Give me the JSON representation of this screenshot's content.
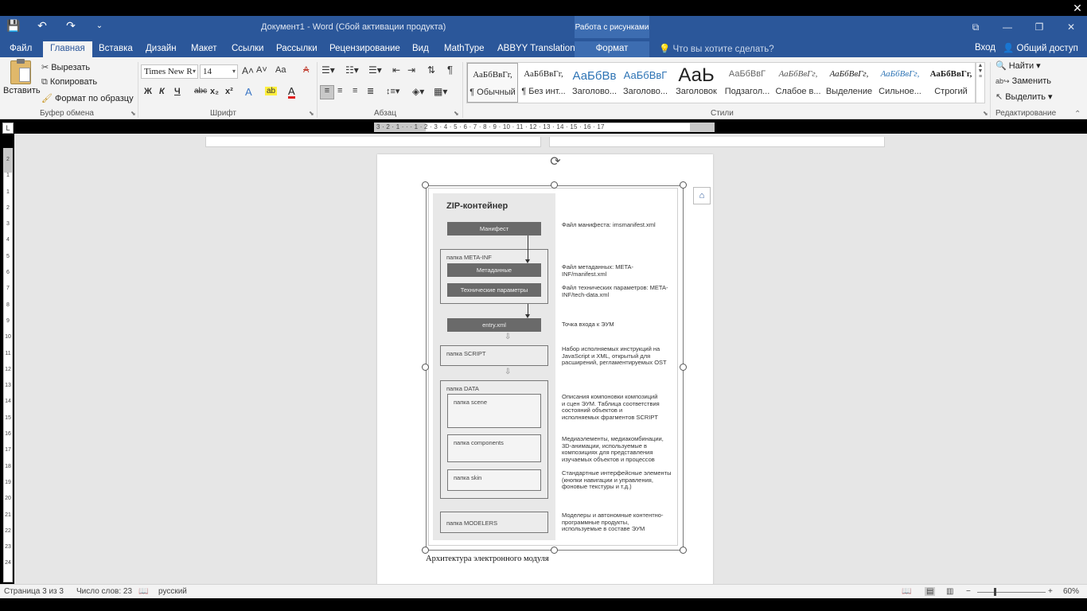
{
  "window": {
    "doc_title": "Документ1 - Word (Сбой активации продукта)",
    "context_tab_group": "Работа с рисунками",
    "controls": [
      "⧉",
      "—",
      "❐",
      "✕"
    ],
    "exit_fullscreen_icon": "✕"
  },
  "qat": {
    "save_icon": "💾",
    "undo_icon": "↶",
    "redo_icon": "↷",
    "customize_icon": "⌄"
  },
  "tabs": [
    "Файл",
    "Главная",
    "Вставка",
    "Дизайн",
    "Макет",
    "Ссылки",
    "Рассылки",
    "Рецензирование",
    "Вид",
    "MathType",
    "ABBYY Translation",
    "Формат"
  ],
  "active_tab": "Главная",
  "tell_me": "Что вы хотите сделать?",
  "login": "Вход",
  "share": "Общий доступ",
  "clipboard": {
    "paste": "Вставить",
    "cut": "Вырезать",
    "copy": "Копировать",
    "format_painter": "Формат по образцу",
    "label": "Буфер обмена"
  },
  "font": {
    "name": "Times New R",
    "size": "14",
    "grow": "A˄",
    "shrink": "A˅",
    "case": "Aa",
    "clear": "A",
    "bold": "Ж",
    "italic": "К",
    "underline": "Ч",
    "strike": "abc",
    "sub": "x₂",
    "sup": "x²",
    "effects": "A",
    "highlight": "ab",
    "color": "A",
    "label": "Шрифт"
  },
  "paragraph": {
    "label": "Абзац",
    "pilcrow": "¶"
  },
  "styles": {
    "label": "Стили",
    "items": [
      {
        "preview": "АаБбВвГг,",
        "name": "¶ Обычный"
      },
      {
        "preview": "АаБбВвГг,",
        "name": "¶ Без инт..."
      },
      {
        "preview": "АаБбВв",
        "name": "Заголово..."
      },
      {
        "preview": "АаБбВвГ",
        "name": "Заголово..."
      },
      {
        "preview": "АаЬ",
        "name": "Заголовок"
      },
      {
        "preview": "АаБбВвГ",
        "name": "Подзагол..."
      },
      {
        "preview": "АаБбВвГг,",
        "name": "Слабое в..."
      },
      {
        "preview": "АаБбВвГг,",
        "name": "Выделение"
      },
      {
        "preview": "АаБбВвГг,",
        "name": "Сильное..."
      },
      {
        "preview": "АаБбВвГг,",
        "name": "Строгий"
      }
    ]
  },
  "editing": {
    "find": "Найти",
    "replace": "Заменить",
    "select": "Выделить",
    "label": "Редактирование"
  },
  "ruler": {
    "corner": "L",
    "h_numbers": "3 · 2 · 1 · · · 1 · 2 · 3 · 4 · 5 · 6 · 7 · 8 · 9 · 10 · 11 · 12 · 13 · 14 · 15 · 16 · 17",
    "v_numbers": [
      "2",
      "1",
      "1",
      "2",
      "3",
      "4",
      "5",
      "6",
      "7",
      "8",
      "9",
      "10",
      "11",
      "12",
      "13",
      "14",
      "15",
      "16",
      "17",
      "18",
      "19",
      "20",
      "21",
      "22",
      "23",
      "24"
    ]
  },
  "diagram": {
    "title": "ZIP-контейнер",
    "manifest": "Манифест",
    "meta_folder": "папка META-INF",
    "metadata": "Метаданные",
    "tech_params": "Технические параметры",
    "entry": "entry.xml",
    "script_folder": "папка SCRIPT",
    "data_folder": "папка DATA",
    "scene_folder": "папка scene",
    "components_folder": "папка components",
    "skin_folder": "папка skin",
    "modelers_folder": "папка MODELERS",
    "notes": {
      "manifest": "Файл манифеста: imsmanifest.xml",
      "metadata": "Файл метаданных: META-INF/manifest.xml",
      "tech": "Файл технических параметров: META-INF/tech-data.xml",
      "entry": "Точка входа к ЭУМ",
      "script": "Набор исполняемых инструкций на JavaScript и XML, открытый для расширений, регламентируемых OST",
      "scene": "Описания компоновки композиций и сцен ЭУМ. Таблица соответствия состояний объектов и исполняемых фрагментов SCRIPT",
      "components": "Медиаэлементы, медиакомбинации, 3D-анимации, используемые в композициях для представления изучаемых объектов и процессов",
      "skin": "Стандартные интерфейсные элементы (кнопки навигации и управления, фоновые текстуры и т.д.)",
      "modelers": "Моделеры и автономные контентно-программные продукты, используемые в составе ЭУМ"
    }
  },
  "caption": "Архитектура электронного модуля",
  "status": {
    "page": "Страница 3 из 3",
    "words": "Число слов: 23",
    "lang": "русский",
    "zoom": "60%",
    "zoom_minus": "−",
    "zoom_plus": "+"
  }
}
